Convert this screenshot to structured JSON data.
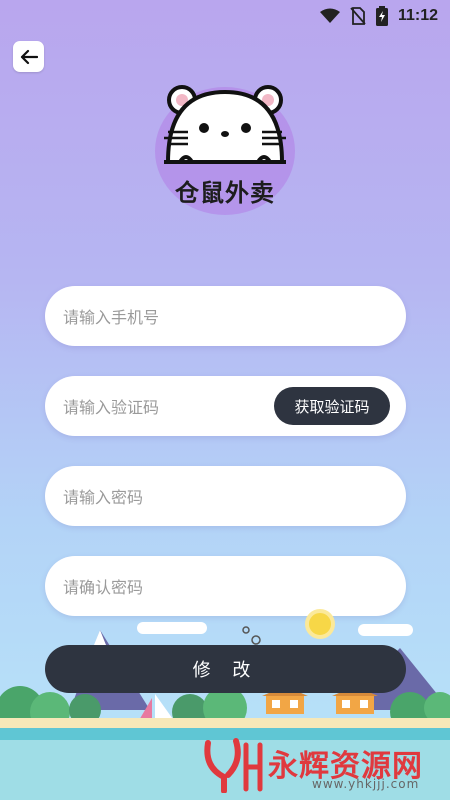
{
  "status_bar": {
    "time": "11:12"
  },
  "header": {
    "back_icon": "arrow-left-icon"
  },
  "brand": {
    "name": "仓鼠外卖",
    "logo_icon": "hamster-logo-icon"
  },
  "form": {
    "phone_placeholder": "请输入手机号",
    "code_placeholder": "请输入验证码",
    "get_code_label": "获取验证码",
    "password_placeholder": "请输入密码",
    "confirm_password_placeholder": "请确认密码",
    "submit_label": "修 改"
  },
  "watermark": {
    "name": "永辉资源网",
    "url": "www.yhkjjj.com"
  },
  "colors": {
    "button_dark": "#2e3440",
    "gradient_top": "#b9a6ee",
    "gradient_bottom": "#b8e6f9",
    "watermark_red": "#e0393e"
  }
}
